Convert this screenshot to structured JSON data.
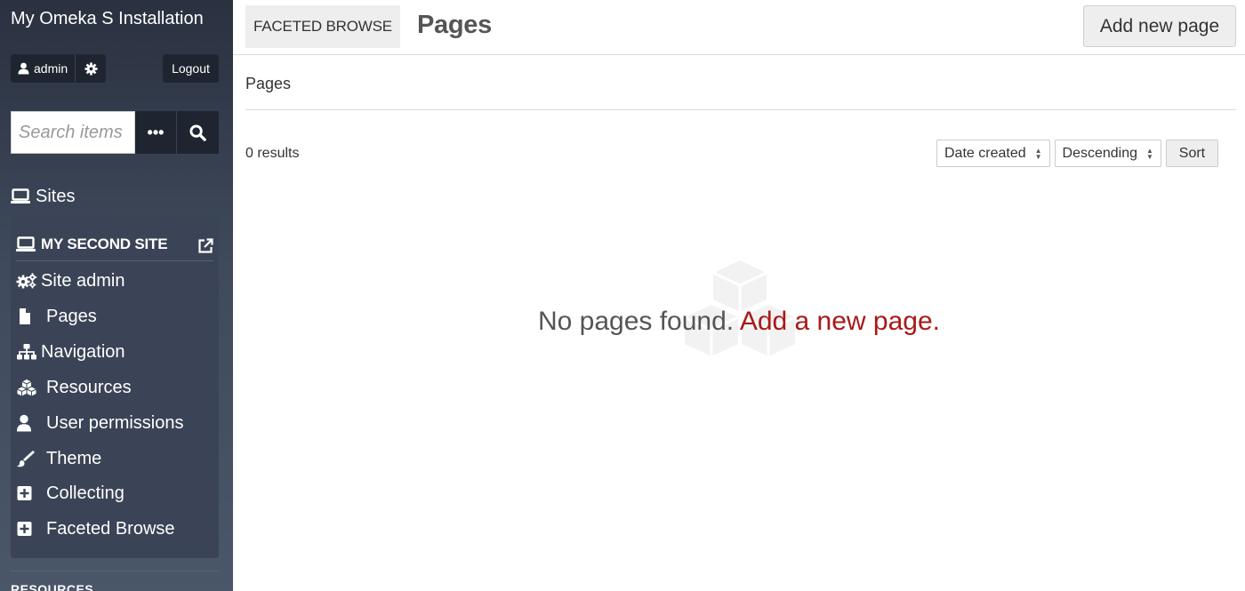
{
  "app": {
    "title": "My Omeka S Installation"
  },
  "user": {
    "name": "admin",
    "logout_label": "Logout"
  },
  "search": {
    "placeholder": "Search items",
    "advanced_label": "•••"
  },
  "sidebar": {
    "sites_label": "Sites",
    "site_name": "MY SECOND SITE",
    "items": [
      {
        "label": "Site admin",
        "icon": "cogs-icon"
      },
      {
        "label": "Pages",
        "icon": "file-icon"
      },
      {
        "label": "Navigation",
        "icon": "sitemap-icon"
      },
      {
        "label": "Resources",
        "icon": "cubes-icon"
      },
      {
        "label": "User permissions",
        "icon": "user-icon"
      },
      {
        "label": "Theme",
        "icon": "paintbrush-icon"
      },
      {
        "label": "Collecting",
        "icon": "plus-square-icon"
      },
      {
        "label": "Faceted Browse",
        "icon": "plus-square-icon"
      }
    ],
    "resources_heading": "RESOURCES"
  },
  "header": {
    "module_label": "FACETED BROWSE",
    "title": "Pages",
    "add_button_label": "Add new page"
  },
  "breadcrumb": {
    "label": "Pages"
  },
  "results": {
    "count_label": "0 results"
  },
  "sort": {
    "by_value": "Date created",
    "order_value": "Descending",
    "button_label": "Sort"
  },
  "empty": {
    "message": "No pages found.",
    "link_label": "Add a new page."
  },
  "colors": {
    "sidebar_top": "#2a3140",
    "sidebar_bottom": "#4a5669",
    "link_red": "#a91919",
    "button_bg": "#eeeeee"
  }
}
